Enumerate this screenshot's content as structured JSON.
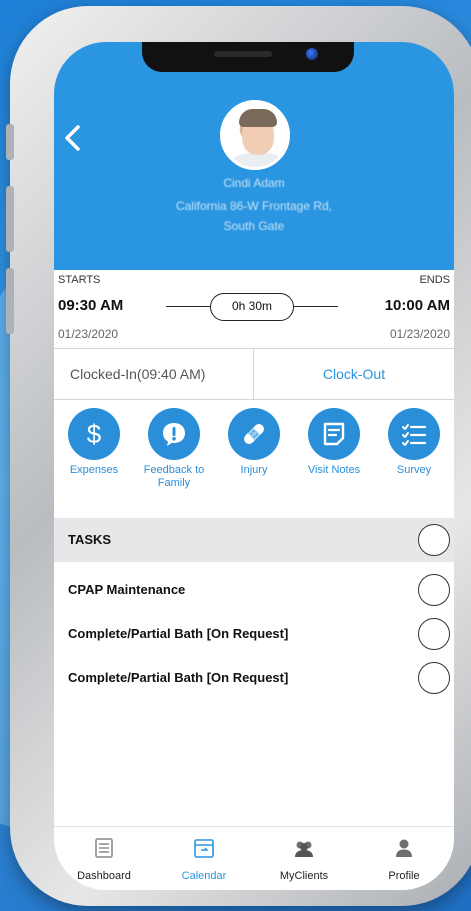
{
  "client": {
    "name": "Cindi Adam",
    "address_line1": "California 86-W Frontage Rd,",
    "address_line2": "South Gate"
  },
  "schedule": {
    "starts_label": "STARTS",
    "ends_label": "ENDS",
    "start_time": "09:30 AM",
    "end_time": "10:00 AM",
    "duration": "0h 30m",
    "start_date": "01/23/2020",
    "end_date": "01/23/2020"
  },
  "clock": {
    "status": "Clocked-In(09:40 AM)",
    "action": "Clock-Out"
  },
  "actions": [
    {
      "label": "Expenses",
      "icon": "dollar-icon"
    },
    {
      "label": "Feedback to Family",
      "icon": "exclamation-bubble-icon"
    },
    {
      "label": "Injury",
      "icon": "bandage-icon"
    },
    {
      "label": "Visit Notes",
      "icon": "notes-icon"
    },
    {
      "label": "Survey",
      "icon": "checklist-icon"
    }
  ],
  "tasks": {
    "title": "TASKS",
    "items": [
      {
        "label": "CPAP Maintenance"
      },
      {
        "label": "Complete/Partial Bath [On Request]"
      },
      {
        "label": "Complete/Partial Bath [On Request]"
      }
    ]
  },
  "tabbar": {
    "items": [
      {
        "label": "Dashboard",
        "icon": "dashboard-icon"
      },
      {
        "label": "Calendar",
        "icon": "calendar-icon",
        "active": true
      },
      {
        "label": "MyClients",
        "icon": "clients-icon"
      },
      {
        "label": "Profile",
        "icon": "profile-icon"
      }
    ]
  },
  "colors": {
    "accent": "#2a95e0",
    "header_bg": "#2a95e0",
    "tasks_header_bg": "#e7e7ea"
  }
}
